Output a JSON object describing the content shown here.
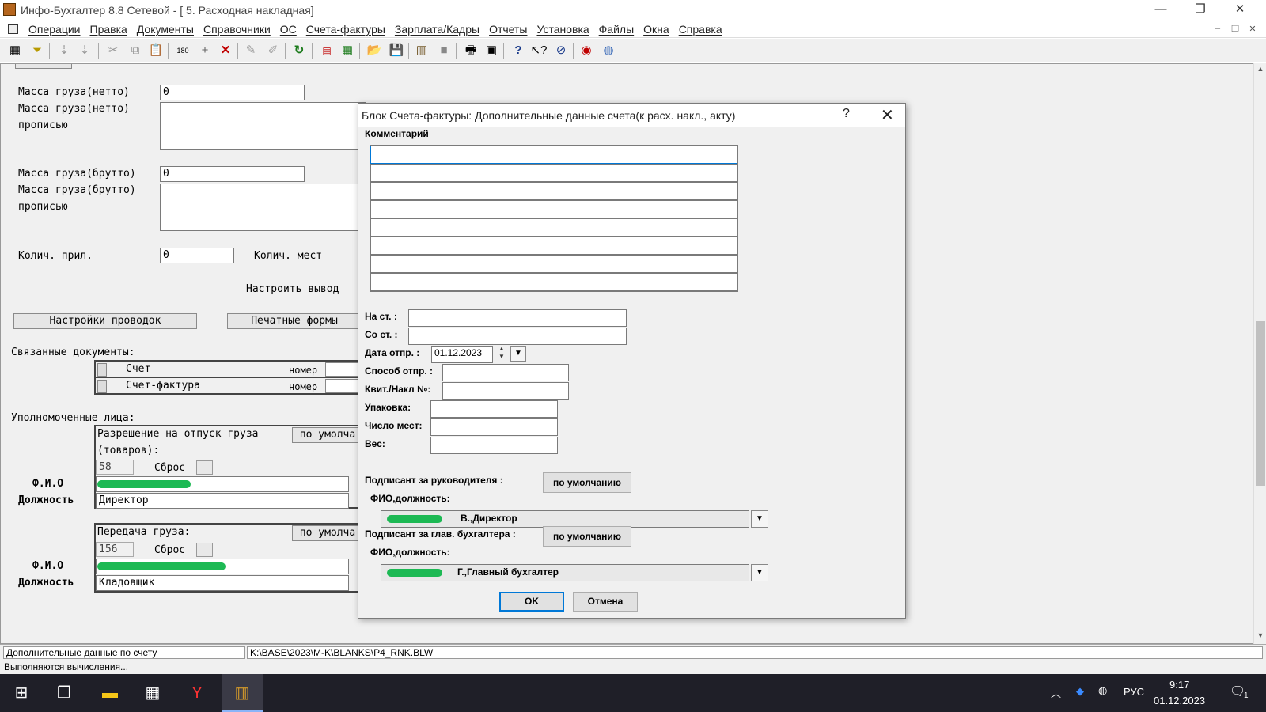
{
  "window": {
    "title": "Инфо-Бухгалтер 8.8 Сетевой - [  5. Расходная накладная]",
    "controls": [
      "—",
      "❐",
      "✕"
    ]
  },
  "menu": {
    "items": [
      "Операции",
      "Правка",
      "Документы",
      "Справочники",
      "ОС",
      "Счета-фактуры",
      "Зарплата/Кадры",
      "Отчеты",
      "Установка",
      "Файлы",
      "Окна",
      "Справка"
    ],
    "mdi_controls": [
      "–",
      "❐",
      "✕"
    ]
  },
  "toolbar": {
    "icons": [
      "grid-icon",
      "filter-icon",
      "sort-asc-icon",
      "sort-desc-icon",
      "cut-icon",
      "copy-icon",
      "paste-icon",
      "counter-icon",
      "add-icon",
      "delete-icon",
      "tool1-icon",
      "tool2-icon",
      "refresh-icon",
      "export-pdf-icon",
      "excel-icon",
      "open-folder-icon",
      "save-icon",
      "books-icon",
      "blank-icon",
      "print-icon",
      "calculator-icon",
      "help-icon",
      "context-help-icon",
      "compass-icon",
      "lifebuoy-icon",
      "globe-icon"
    ]
  },
  "form": {
    "mass_net_label": "Масса груза(нетто)",
    "mass_net_value": "0",
    "mass_net_words_label_1": "Масса груза(нетто)",
    "mass_net_words_label_2": "прописью",
    "mass_gross_label": "Масса груза(брутто)",
    "mass_gross_value": "0",
    "mass_gross_words_label_1": "Масса груза(брутто)",
    "mass_gross_words_label_2": "прописью",
    "attachments_label": "Колич. прил.",
    "attachments_value": "0",
    "places_label": "Колич. мест",
    "configure_output": "Настроить вывод",
    "postings_button": "Настройки проводок",
    "print_forms_button": "Печатные формы",
    "related_docs_label": "Связанные документы:",
    "related_docs": [
      {
        "name": "Счет",
        "num_label": "номер"
      },
      {
        "name": "Счет-фактура",
        "num_label": "номер"
      }
    ],
    "authorized_label": "Уполномоченные лица:",
    "release": {
      "title_1": "Разрешение на отпуск груза",
      "title_2": "(товаров):",
      "default_btn": "по умолча",
      "code": "58",
      "reset_label": "Сброс",
      "fio_label": "Ф.И.О",
      "fio_value": "",
      "position_label": "Должность",
      "position_value": "Директор"
    },
    "handover": {
      "title": "Передача груза:",
      "default_btn": "по умолча",
      "code": "156",
      "reset_label": "Сброс",
      "fio_label": "Ф.И.О",
      "fio_value": "",
      "position_label": "Должность",
      "position_value": "Кладовщик"
    }
  },
  "dialog": {
    "title": "Блок Счета-фактуры: Дополнительные данные счета(к расх. накл., акту)",
    "help": "?",
    "close": "✕",
    "comment_label": "Комментарий",
    "comment_lines": [
      "",
      "",
      "",
      "",
      "",
      "",
      "",
      ""
    ],
    "na_st_label": "На ст.  :",
    "na_st_value": "",
    "so_st_label": "Со ст.  :",
    "so_st_value": "",
    "ship_date_label": "Дата отпр.  :",
    "ship_date_value": "01.12.2023",
    "ship_method_label": "Способ отпр.  :",
    "ship_method_value": "",
    "receipt_label": "Квит./Накл №:",
    "receipt_value": "",
    "packing_label": "Упаковка:",
    "packing_value": "",
    "places_label": "Число мест:",
    "places_value": "",
    "weight_label": "Вес:",
    "weight_value": "",
    "signer_head_label": "Подписант за руководителя  :",
    "signer_head_default": "по умолчанию",
    "signer_head_fio_label": "ФИО,должность:",
    "signer_head_fio_visible": "В.,Директор",
    "signer_acc_label": "Подписант за глав. бухгалтера    :",
    "signer_acc_default": "по умолчанию",
    "signer_acc_fio_label": "ФИО,должность:",
    "signer_acc_fio_visible": "Г.,Главный бухгалтер",
    "ok": "OK",
    "cancel": "Отмена"
  },
  "status": {
    "left": "Дополнительные данные по счету",
    "path": "K:\\BASE\\2023\\M-K\\BLANKS\\P4_RNK.BLW",
    "bottom": "Выполняются вычисления..."
  },
  "taskbar": {
    "lang": "РУС",
    "time": "9:17",
    "date": "01.12.2023",
    "notifications": "1"
  }
}
